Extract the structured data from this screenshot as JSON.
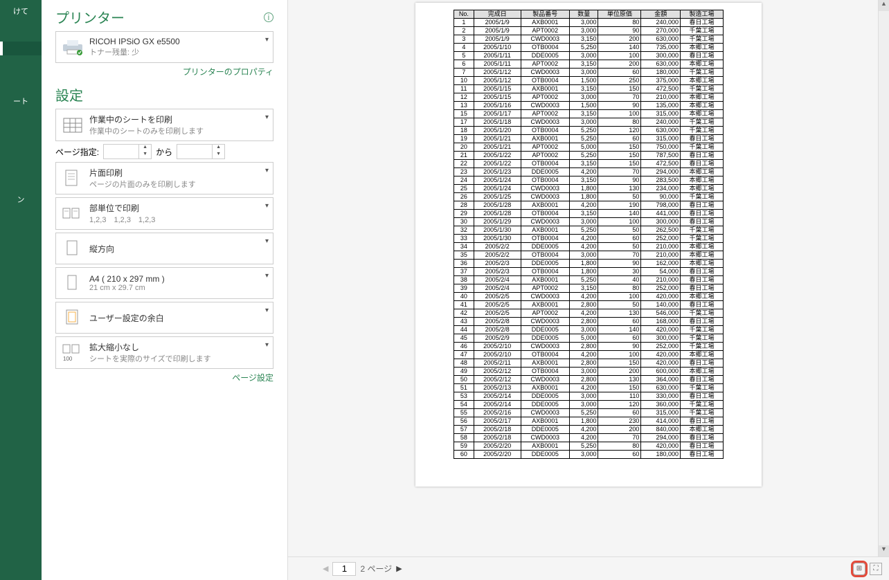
{
  "leftnav": {
    "item1": "けて",
    "item2": "",
    "item3": "ート",
    "item4": "ン"
  },
  "printer": {
    "section": "プリンター",
    "name": "RICOH IPSiO GX e5500",
    "status": "トナー残量: 少",
    "properties_link": "プリンターのプロパティ"
  },
  "settings": {
    "section": "設定",
    "print_what": {
      "t1": "作業中のシートを印刷",
      "t2": "作業中のシートのみを印刷します"
    },
    "page_label": "ページ指定:",
    "to_label": "から",
    "sides": {
      "t1": "片面印刷",
      "t2": "ページの片面のみを印刷します"
    },
    "collate": {
      "t1": "部単位で印刷",
      "t2": "1,2,3　1,2,3　1,2,3"
    },
    "orient": {
      "t1": "縦方向"
    },
    "paper": {
      "t1": "A4 ( 210 x 297 mm )",
      "t2": "21 cm x 29.7 cm"
    },
    "margins": {
      "t1": "ユーザー設定の余白"
    },
    "scale": {
      "t1": "拡大縮小なし",
      "t2": "シートを実際のサイズで印刷します"
    },
    "page_setup": "ページ設定"
  },
  "table": {
    "headers": [
      "No.",
      "完成日",
      "製品番号",
      "数量",
      "単位原価",
      "金額",
      "製造工場"
    ],
    "rows": [
      [
        "1",
        "2005/1/9",
        "AXB0001",
        "3,000",
        "80",
        "240,000",
        "春日工場"
      ],
      [
        "2",
        "2005/1/9",
        "APT0002",
        "3,000",
        "90",
        "270,000",
        "千葉工場"
      ],
      [
        "3",
        "2005/1/9",
        "CWD0003",
        "3,150",
        "200",
        "630,000",
        "千葉工場"
      ],
      [
        "4",
        "2005/1/10",
        "OTB0004",
        "5,250",
        "140",
        "735,000",
        "本郷工場"
      ],
      [
        "5",
        "2005/1/11",
        "DDE0005",
        "3,000",
        "100",
        "300,000",
        "春日工場"
      ],
      [
        "6",
        "2005/1/11",
        "APT0002",
        "3,150",
        "200",
        "630,000",
        "本郷工場"
      ],
      [
        "7",
        "2005/1/12",
        "CWD0003",
        "3,000",
        "60",
        "180,000",
        "千葉工場"
      ],
      [
        "10",
        "2005/1/12",
        "OTB0004",
        "1,500",
        "250",
        "375,000",
        "本郷工場"
      ],
      [
        "11",
        "2005/1/15",
        "AXB0001",
        "3,150",
        "150",
        "472,500",
        "千葉工場"
      ],
      [
        "12",
        "2005/1/15",
        "APT0002",
        "3,000",
        "70",
        "210,000",
        "本郷工場"
      ],
      [
        "13",
        "2005/1/16",
        "CWD0003",
        "1,500",
        "90",
        "135,000",
        "本郷工場"
      ],
      [
        "15",
        "2005/1/17",
        "APT0002",
        "3,150",
        "100",
        "315,000",
        "本郷工場"
      ],
      [
        "17",
        "2005/1/18",
        "CWD0003",
        "3,000",
        "80",
        "240,000",
        "千葉工場"
      ],
      [
        "18",
        "2005/1/20",
        "OTB0004",
        "5,250",
        "120",
        "630,000",
        "千葉工場"
      ],
      [
        "19",
        "2005/1/21",
        "AXB0001",
        "5,250",
        "60",
        "315,000",
        "春日工場"
      ],
      [
        "20",
        "2005/1/21",
        "APT0002",
        "5,000",
        "150",
        "750,000",
        "千葉工場"
      ],
      [
        "21",
        "2005/1/22",
        "APT0002",
        "5,250",
        "150",
        "787,500",
        "春日工場"
      ],
      [
        "22",
        "2005/1/22",
        "OTB0004",
        "3,150",
        "150",
        "472,500",
        "春日工場"
      ],
      [
        "23",
        "2005/1/23",
        "DDE0005",
        "4,200",
        "70",
        "294,000",
        "本郷工場"
      ],
      [
        "24",
        "2005/1/24",
        "OTB0004",
        "3,150",
        "90",
        "283,500",
        "本郷工場"
      ],
      [
        "25",
        "2005/1/24",
        "CWD0003",
        "1,800",
        "130",
        "234,000",
        "本郷工場"
      ],
      [
        "26",
        "2005/1/25",
        "CWD0003",
        "1,800",
        "50",
        "90,000",
        "千葉工場"
      ],
      [
        "28",
        "2005/1/28",
        "AXB0001",
        "4,200",
        "190",
        "798,000",
        "春日工場"
      ],
      [
        "29",
        "2005/1/28",
        "OTB0004",
        "3,150",
        "140",
        "441,000",
        "春日工場"
      ],
      [
        "30",
        "2005/1/29",
        "CWD0003",
        "3,000",
        "100",
        "300,000",
        "春日工場"
      ],
      [
        "32",
        "2005/1/30",
        "AXB0001",
        "5,250",
        "50",
        "262,500",
        "千葉工場"
      ],
      [
        "33",
        "2005/1/30",
        "OTB0004",
        "4,200",
        "60",
        "252,000",
        "千葉工場"
      ],
      [
        "34",
        "2005/2/2",
        "DDE0005",
        "4,200",
        "50",
        "210,000",
        "本郷工場"
      ],
      [
        "35",
        "2005/2/2",
        "OTB0004",
        "3,000",
        "70",
        "210,000",
        "本郷工場"
      ],
      [
        "36",
        "2005/2/3",
        "DDE0005",
        "1,800",
        "90",
        "162,000",
        "本郷工場"
      ],
      [
        "37",
        "2005/2/3",
        "OTB0004",
        "1,800",
        "30",
        "54,000",
        "春日工場"
      ],
      [
        "38",
        "2005/2/4",
        "AXB0001",
        "5,250",
        "40",
        "210,000",
        "春日工場"
      ],
      [
        "39",
        "2005/2/4",
        "APT0002",
        "3,150",
        "80",
        "252,000",
        "春日工場"
      ],
      [
        "40",
        "2005/2/5",
        "CWD0003",
        "4,200",
        "100",
        "420,000",
        "本郷工場"
      ],
      [
        "41",
        "2005/2/5",
        "AXB0001",
        "2,800",
        "50",
        "140,000",
        "春日工場"
      ],
      [
        "42",
        "2005/2/5",
        "APT0002",
        "4,200",
        "130",
        "546,000",
        "千葉工場"
      ],
      [
        "43",
        "2005/2/8",
        "CWD0003",
        "2,800",
        "60",
        "168,000",
        "春日工場"
      ],
      [
        "44",
        "2005/2/8",
        "DDE0005",
        "3,000",
        "140",
        "420,000",
        "千葉工場"
      ],
      [
        "45",
        "2005/2/9",
        "DDE0005",
        "5,000",
        "60",
        "300,000",
        "千葉工場"
      ],
      [
        "46",
        "2005/2/10",
        "CWD0003",
        "2,800",
        "90",
        "252,000",
        "千葉工場"
      ],
      [
        "47",
        "2005/2/10",
        "OTB0004",
        "4,200",
        "100",
        "420,000",
        "本郷工場"
      ],
      [
        "48",
        "2005/2/11",
        "AXB0001",
        "2,800",
        "150",
        "420,000",
        "春日工場"
      ],
      [
        "49",
        "2005/2/12",
        "OTB0004",
        "3,000",
        "200",
        "600,000",
        "本郷工場"
      ],
      [
        "50",
        "2005/2/12",
        "CWD0003",
        "2,800",
        "130",
        "364,000",
        "春日工場"
      ],
      [
        "51",
        "2005/2/13",
        "AXB0001",
        "4,200",
        "150",
        "630,000",
        "千葉工場"
      ],
      [
        "53",
        "2005/2/14",
        "DDE0005",
        "3,000",
        "110",
        "330,000",
        "春日工場"
      ],
      [
        "54",
        "2005/2/14",
        "DDE0005",
        "3,000",
        "120",
        "360,000",
        "千葉工場"
      ],
      [
        "55",
        "2005/2/16",
        "CWD0003",
        "5,250",
        "60",
        "315,000",
        "千葉工場"
      ],
      [
        "56",
        "2005/2/17",
        "AXB0001",
        "1,800",
        "230",
        "414,000",
        "春日工場"
      ],
      [
        "57",
        "2005/2/18",
        "DDE0005",
        "4,200",
        "200",
        "840,000",
        "本郷工場"
      ],
      [
        "58",
        "2005/2/18",
        "CWD0003",
        "4,200",
        "70",
        "294,000",
        "春日工場"
      ],
      [
        "59",
        "2005/2/20",
        "AXB0001",
        "5,250",
        "80",
        "420,000",
        "春日工場"
      ],
      [
        "60",
        "2005/2/20",
        "DDE0005",
        "3,000",
        "60",
        "180,000",
        "春日工場"
      ]
    ]
  },
  "pager": {
    "page": "1",
    "total_label": "2 ページ"
  },
  "icons": {
    "grid": "⊞",
    "zoom": "⛶"
  }
}
